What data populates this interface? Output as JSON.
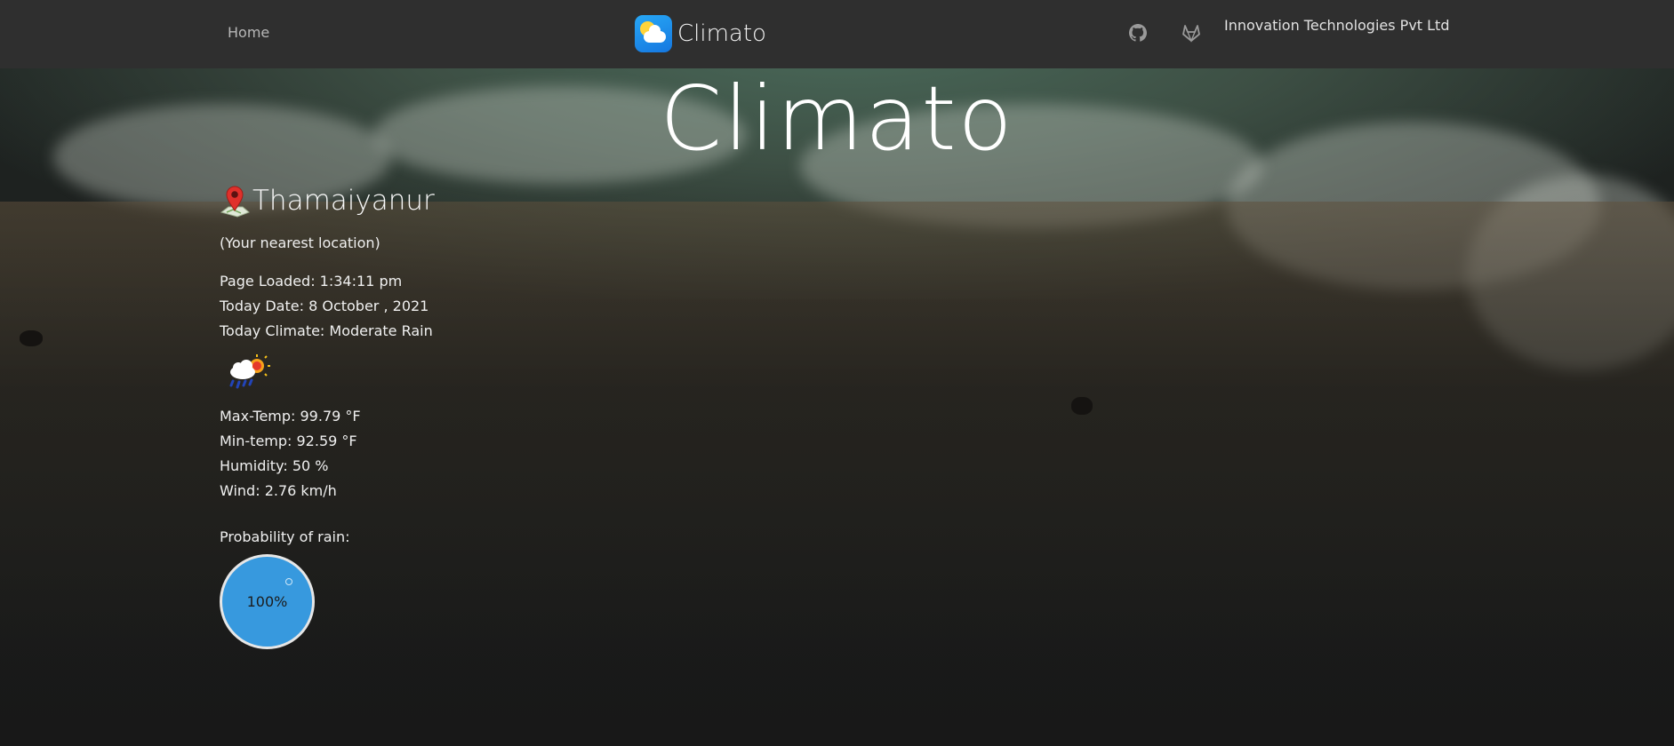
{
  "nav": {
    "home_label": "Home",
    "brand_title": "Climato",
    "company": "Innovation Technologies Pvt Ltd",
    "icons": [
      "github-icon",
      "gitlab-icon",
      "climato-logo-icon"
    ]
  },
  "hero": {
    "title": "Climato"
  },
  "location": {
    "name": "Thamaiyanur",
    "note": "(Your nearest location)",
    "icon": "map-pin-icon"
  },
  "details": {
    "page_loaded": "Page Loaded: 1:34:11 pm",
    "today_date": "Today Date: 8 October , 2021",
    "today_climate": "Today Climate: Moderate Rain",
    "weather_icon": "rain-sun-cloud-icon"
  },
  "stats": {
    "max_temp": "Max-Temp: 99.79 °F",
    "min_temp": "Min-temp: 92.59 °F",
    "humidity": "Humidity: 50 %",
    "wind": "Wind: 2.76 km/h"
  },
  "rain": {
    "label": "Probability of rain:",
    "value_text": "100%",
    "probability": 1.0
  },
  "colors": {
    "navbar": "#2f2f2f",
    "gauge_fill": "#3799de",
    "text": "#f0f0f0"
  }
}
